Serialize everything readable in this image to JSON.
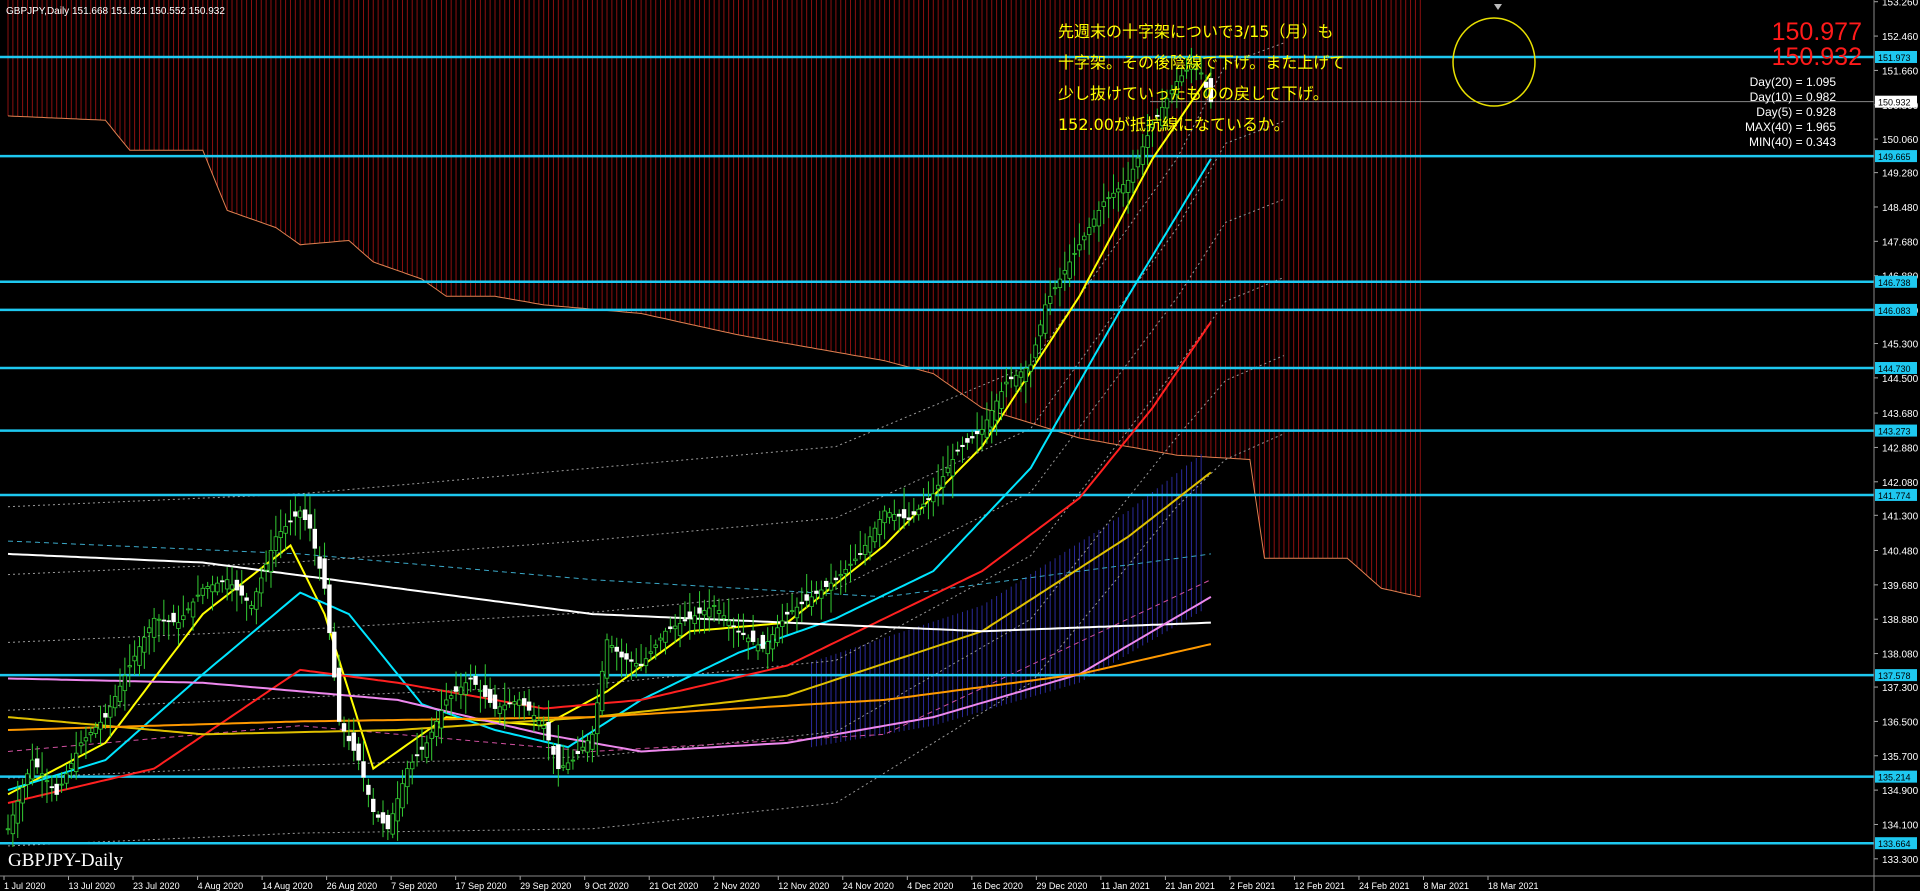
{
  "header": {
    "symbol_line": "GBPJPY,Daily  151.668 151.821 150.552 150.932",
    "watermark": "GBPJPY-Daily"
  },
  "annotation": {
    "lines": [
      "先週末の十字架についで3/15（月）も",
      "十字架。その後陰線で下げ。また上げて",
      "少し抜けていったものの戻して下げ。",
      "152.00が抵抗線になているか。"
    ]
  },
  "price_box": {
    "ask": "150.977",
    "bid": "150.932"
  },
  "stats": [
    "Day(20) = 1.095",
    "Day(10) = 0.982",
    "Day(5) = 0.928",
    "MAX(40) = 1.965",
    "MIN(40) = 0.343"
  ],
  "chart_data": {
    "type": "line",
    "title": "GBPJPY,Daily",
    "price_axis": {
      "ylim": [
        132.9,
        153.3
      ],
      "ticks": [
        "153.260",
        "152.460",
        "151.660",
        "150.860",
        "150.060",
        "149.280",
        "148.480",
        "147.680",
        "146.880",
        "146.080",
        "145.300",
        "144.500",
        "143.680",
        "142.880",
        "142.080",
        "141.300",
        "140.480",
        "139.680",
        "138.880",
        "138.080",
        "137.300",
        "136.500",
        "135.700",
        "134.900",
        "134.100",
        "133.300"
      ]
    },
    "time_axis": {
      "labels": [
        "1 Jul 2020",
        "13 Jul 2020",
        "23 Jul 2020",
        "4 Aug 2020",
        "14 Aug 2020",
        "26 Aug 2020",
        "7 Sep 2020",
        "17 Sep 2020",
        "29 Sep 2020",
        "9 Oct 2020",
        "21 Oct 2020",
        "2 Nov 2020",
        "12 Nov 2020",
        "24 Nov 2020",
        "4 Dec 2020",
        "16 Dec 2020",
        "29 Dec 2020",
        "11 Jan 2021",
        "21 Jan 2021",
        "2 Feb 2021",
        "12 Feb 2021",
        "24 Feb 2021",
        "8 Mar 2021",
        "18 Mar 2021"
      ]
    },
    "horizontal_levels": [
      {
        "value": 151.973,
        "label": "151.973"
      },
      {
        "value": 149.665,
        "label": "149.665"
      },
      {
        "value": 146.738,
        "label": "146.738"
      },
      {
        "value": 146.083,
        "label": "146.083"
      },
      {
        "value": 144.73,
        "label": "144.730"
      },
      {
        "value": 143.273,
        "label": "143.273"
      },
      {
        "value": 141.774,
        "label": "141.774"
      },
      {
        "value": 137.578,
        "label": "137.578"
      },
      {
        "value": 135.214,
        "label": "135.214"
      },
      {
        "value": 133.664,
        "label": "133.664"
      }
    ],
    "current_price": {
      "value": 150.932,
      "label": "150.932"
    },
    "price_anchors": [
      [
        0,
        134.0
      ],
      [
        5,
        135.6
      ],
      [
        10,
        134.8
      ],
      [
        15,
        136.0
      ],
      [
        20,
        136.6
      ],
      [
        25,
        137.8
      ],
      [
        30,
        138.9
      ],
      [
        35,
        138.8
      ],
      [
        40,
        139.6
      ],
      [
        45,
        139.8
      ],
      [
        50,
        139.2
      ],
      [
        55,
        140.8
      ],
      [
        60,
        141.4
      ],
      [
        62,
        141.0
      ],
      [
        65,
        139.6
      ],
      [
        68,
        136.5
      ],
      [
        72,
        135.6
      ],
      [
        75,
        134.4
      ],
      [
        78,
        134.0
      ],
      [
        82,
        135.4
      ],
      [
        86,
        136.0
      ],
      [
        90,
        137.0
      ],
      [
        95,
        137.5
      ],
      [
        100,
        136.8
      ],
      [
        105,
        137.0
      ],
      [
        110,
        136.4
      ],
      [
        113,
        135.4
      ],
      [
        116,
        135.6
      ],
      [
        120,
        136.2
      ],
      [
        123,
        138.4
      ],
      [
        126,
        138.0
      ],
      [
        130,
        137.8
      ],
      [
        135,
        138.6
      ],
      [
        140,
        138.9
      ],
      [
        145,
        139.2
      ],
      [
        150,
        138.6
      ],
      [
        155,
        138.2
      ],
      [
        160,
        139.0
      ],
      [
        165,
        139.4
      ],
      [
        170,
        139.8
      ],
      [
        175,
        140.4
      ],
      [
        180,
        141.4
      ],
      [
        185,
        141.2
      ],
      [
        190,
        141.8
      ],
      [
        195,
        142.8
      ],
      [
        200,
        143.3
      ],
      [
        205,
        144.4
      ],
      [
        210,
        144.8
      ],
      [
        213,
        146.2
      ],
      [
        216,
        146.8
      ],
      [
        220,
        147.6
      ],
      [
        225,
        148.6
      ],
      [
        230,
        149.1
      ],
      [
        235,
        150.4
      ],
      [
        240,
        151.4
      ],
      [
        243,
        151.8
      ],
      [
        245,
        151.6
      ],
      [
        247,
        150.93
      ]
    ],
    "series": [
      {
        "color": "#ffff00",
        "anchors": [
          [
            0,
            134.8
          ],
          [
            20,
            136.0
          ],
          [
            40,
            139.0
          ],
          [
            58,
            140.6
          ],
          [
            65,
            139.0
          ],
          [
            75,
            135.4
          ],
          [
            90,
            136.6
          ],
          [
            110,
            136.4
          ],
          [
            123,
            137.2
          ],
          [
            140,
            138.6
          ],
          [
            160,
            138.8
          ],
          [
            180,
            140.6
          ],
          [
            200,
            142.9
          ],
          [
            220,
            146.4
          ],
          [
            235,
            149.6
          ],
          [
            247,
            151.6
          ]
        ]
      },
      {
        "color": "#00e5ff",
        "anchors": [
          [
            0,
            134.9
          ],
          [
            20,
            135.6
          ],
          [
            40,
            137.6
          ],
          [
            60,
            139.5
          ],
          [
            70,
            139.0
          ],
          [
            85,
            136.9
          ],
          [
            100,
            136.3
          ],
          [
            115,
            135.9
          ],
          [
            130,
            137.0
          ],
          [
            150,
            138.1
          ],
          [
            170,
            138.9
          ],
          [
            190,
            140.0
          ],
          [
            210,
            142.4
          ],
          [
            230,
            146.4
          ],
          [
            247,
            149.6
          ]
        ]
      },
      {
        "color": "#ff2020",
        "anchors": [
          [
            0,
            134.6
          ],
          [
            30,
            135.4
          ],
          [
            60,
            137.7
          ],
          [
            80,
            137.4
          ],
          [
            110,
            136.8
          ],
          [
            130,
            137.0
          ],
          [
            160,
            137.8
          ],
          [
            180,
            138.9
          ],
          [
            200,
            140.0
          ],
          [
            220,
            141.7
          ],
          [
            235,
            143.8
          ],
          [
            247,
            145.8
          ]
        ]
      },
      {
        "color": "#e0c000",
        "anchors": [
          [
            0,
            136.6
          ],
          [
            40,
            136.2
          ],
          [
            80,
            136.3
          ],
          [
            120,
            136.6
          ],
          [
            160,
            137.1
          ],
          [
            200,
            138.6
          ],
          [
            230,
            140.8
          ],
          [
            247,
            142.3
          ]
        ]
      },
      {
        "color": "#ffffff",
        "anchors": [
          [
            0,
            140.4
          ],
          [
            40,
            140.2
          ],
          [
            80,
            139.6
          ],
          [
            120,
            139.0
          ],
          [
            160,
            138.8
          ],
          [
            200,
            138.6
          ],
          [
            247,
            138.8
          ]
        ]
      },
      {
        "color": "#ee88ee",
        "anchors": [
          [
            0,
            137.5
          ],
          [
            40,
            137.4
          ],
          [
            80,
            137.0
          ],
          [
            110,
            136.2
          ],
          [
            130,
            135.8
          ],
          [
            160,
            136.0
          ],
          [
            190,
            136.6
          ],
          [
            220,
            137.6
          ],
          [
            247,
            139.4
          ]
        ]
      },
      {
        "color": "#ff9900",
        "anchors": [
          [
            0,
            136.3
          ],
          [
            60,
            136.5
          ],
          [
            120,
            136.6
          ],
          [
            180,
            137.0
          ],
          [
            220,
            137.6
          ],
          [
            247,
            138.3
          ]
        ]
      }
    ],
    "cloud_edge": [
      [
        0,
        150.6
      ],
      [
        20,
        150.5
      ],
      [
        25,
        149.8
      ],
      [
        40,
        149.8
      ],
      [
        45,
        148.4
      ],
      [
        55,
        148.0
      ],
      [
        60,
        147.6
      ],
      [
        70,
        147.7
      ],
      [
        75,
        147.2
      ],
      [
        85,
        146.8
      ],
      [
        90,
        146.4
      ],
      [
        100,
        146.4
      ],
      [
        110,
        146.2
      ],
      [
        130,
        146.0
      ],
      [
        150,
        145.5
      ],
      [
        170,
        145.1
      ],
      [
        180,
        144.9
      ],
      [
        190,
        144.6
      ],
      [
        200,
        143.8
      ],
      [
        220,
        143.1
      ],
      [
        240,
        142.7
      ],
      [
        255,
        142.6
      ],
      [
        258,
        140.3
      ],
      [
        275,
        140.3
      ],
      [
        282,
        139.6
      ],
      [
        290,
        139.4
      ]
    ],
    "bands": {
      "upper": [
        [
          0,
          141.5
        ],
        [
          60,
          141.8
        ],
        [
          120,
          142.4
        ],
        [
          170,
          142.9
        ],
        [
          210,
          144.8
        ],
        [
          240,
          149.6
        ],
        [
          250,
          151.8
        ],
        [
          262,
          152.3
        ]
      ],
      "lower": [
        [
          0,
          133.6
        ],
        [
          60,
          133.9
        ],
        [
          120,
          134.0
        ],
        [
          170,
          134.6
        ],
        [
          210,
          137.4
        ],
        [
          240,
          141.5
        ],
        [
          250,
          142.6
        ],
        [
          262,
          143.2
        ]
      ]
    }
  }
}
